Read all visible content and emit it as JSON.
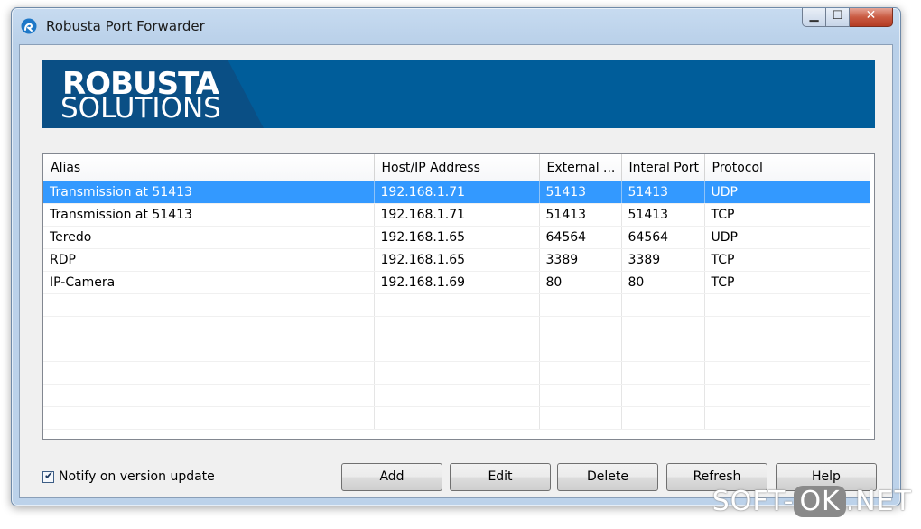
{
  "window": {
    "title": "Robusta Port Forwarder"
  },
  "banner": {
    "logo_line1": "ROBUSTA",
    "logo_line2": "SOLUTIONS",
    "background_color": "#005d9a"
  },
  "table": {
    "columns": [
      "Alias",
      "Host/IP Address",
      "External ...",
      "Interal Port",
      "Protocol"
    ],
    "rows": [
      {
        "alias": "Transmission at 51413",
        "host": "192.168.1.71",
        "external": "51413",
        "internal": "51413",
        "protocol": "UDP",
        "selected": true
      },
      {
        "alias": "Transmission at 51413",
        "host": "192.168.1.71",
        "external": "51413",
        "internal": "51413",
        "protocol": "TCP",
        "selected": false
      },
      {
        "alias": "Teredo",
        "host": "192.168.1.65",
        "external": "64564",
        "internal": "64564",
        "protocol": "UDP",
        "selected": false
      },
      {
        "alias": "RDP",
        "host": "192.168.1.65",
        "external": "3389",
        "internal": "3389",
        "protocol": "TCP",
        "selected": false
      },
      {
        "alias": "IP-Camera",
        "host": "192.168.1.69",
        "external": "80",
        "internal": "80",
        "protocol": "TCP",
        "selected": false
      }
    ],
    "selection_color": "#3399ff"
  },
  "notify": {
    "label": "Notify on version update",
    "checked": true
  },
  "buttons": {
    "add": "Add",
    "edit": "Edit",
    "delete": "Delete",
    "refresh": "Refresh",
    "help": "Help"
  },
  "watermark": {
    "part1": "SOFT-",
    "part2": "OK",
    "part3": ".NET"
  }
}
